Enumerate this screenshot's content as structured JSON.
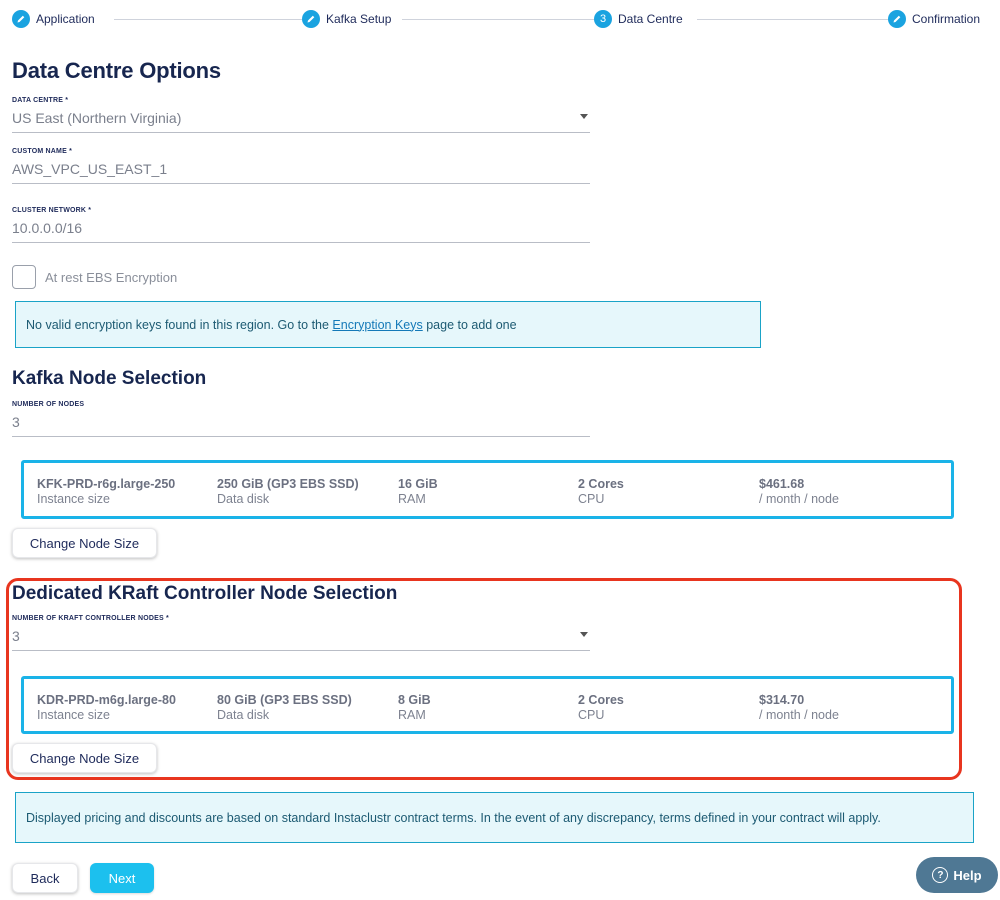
{
  "stepper": {
    "steps": [
      {
        "label": "Application",
        "icon": "pencil-icon",
        "marker": ""
      },
      {
        "label": "Kafka Setup",
        "icon": "pencil-icon",
        "marker": ""
      },
      {
        "label": "Data Centre",
        "icon": "",
        "marker": "3"
      },
      {
        "label": "Confirmation",
        "icon": "pencil-icon",
        "marker": ""
      }
    ],
    "active_color": "#1aa3e0"
  },
  "data_centre": {
    "title": "Data Centre Options",
    "region_label": "DATA CENTRE *",
    "region_value": "US East (Northern Virginia)",
    "custom_name_label": "CUSTOM NAME *",
    "custom_name_value": "AWS_VPC_US_EAST_1",
    "network_label": "CLUSTER NETWORK *",
    "network_value": "10.0.0.0/16",
    "encryption_label": "At rest EBS Encryption",
    "encryption_checked": false,
    "encryption_notice_prefix": "No valid encryption keys found in this region. Go to the ",
    "encryption_notice_link": "Encryption Keys",
    "encryption_notice_suffix": " page to add one"
  },
  "kafka_nodes": {
    "title": "Kafka Node Selection",
    "count_label": "NUMBER OF NODES",
    "count_value": "3",
    "card": {
      "instance": "KFK-PRD-r6g.large-250",
      "instance_sub": "Instance size",
      "disk": "250 GiB (GP3 EBS SSD)",
      "disk_sub": "Data disk",
      "ram": "16 GiB",
      "ram_sub": "RAM",
      "cpu": "2 Cores",
      "cpu_sub": "CPU",
      "price": "$461.68",
      "price_sub": "/ month / node"
    },
    "change_button": "Change Node Size"
  },
  "kraft_nodes": {
    "title": "Dedicated KRaft Controller Node Selection",
    "count_label": "NUMBER OF KRAFT CONTROLLER NODES *",
    "count_value": "3",
    "card": {
      "instance": "KDR-PRD-m6g.large-80",
      "instance_sub": "Instance size",
      "disk": "80 GiB (GP3 EBS SSD)",
      "disk_sub": "Data disk",
      "ram": "8 GiB",
      "ram_sub": "RAM",
      "cpu": "2 Cores",
      "cpu_sub": "CPU",
      "price": "$314.70",
      "price_sub": "/ month / node"
    },
    "change_button": "Change Node Size",
    "highlight_color": "#e8351f"
  },
  "pricing_notice": "Displayed pricing and discounts are based on standard Instaclustr contract terms. In the event of any discrepancy, terms defined in your contract will apply.",
  "footer": {
    "back_label": "Back",
    "next_label": "Next",
    "help_label": "Help",
    "help_icon": "question-circle-icon"
  }
}
